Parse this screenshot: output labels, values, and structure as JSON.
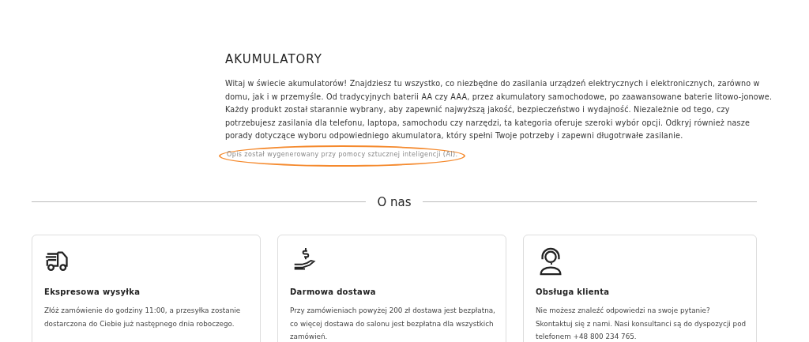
{
  "category": {
    "title": "AKUMULATORY",
    "description": "Witaj w świecie akumulatorów! Znajdziesz tu wszystko, co niezbędne do zasilania urządzeń elektrycznych i elektronicznych, zarówno w domu, jak i w przemyśle. Od tradycyjnych baterii AA czy AAA, przez akumulatory samochodowe, po zaawansowane baterie litowo-jonowe. Każdy produkt został starannie wybrany, aby zapewnić najwyższą jakość, bezpieczeństwo i wydajność. Niezależnie od tego, czy potrzebujesz zasilania dla telefonu, laptopa, samochodu czy narzędzi, ta kategoria oferuje szeroki wybór opcji. Odkryj również nasze porady dotyczące wyboru odpowiedniego akumulatora, który spełni Twoje potrzeby i zapewni długotrwałe zasilanie.",
    "ai_note": {
      "text": "Opis został wygenerowany przy pomocy sztucznej inteligencji (AI).",
      "highlighted": true
    }
  },
  "about": {
    "heading": "O nas",
    "features": [
      {
        "kind": "truck",
        "title": "Ekspresowa wysyłka",
        "text": "Złóż zamówienie do godziny 11:00, a przesyłka zostanie dostarczona do Ciebie już następnego dnia roboczego."
      },
      {
        "kind": "money",
        "title": "Darmowa dostawa",
        "text": "Przy zamówieniach powyżej 200 zł dostawa jest bezpłatna, co więcej dostawa do salonu jest bezpłatna dla wszystkich zamówień."
      },
      {
        "kind": "support",
        "title": "Obsługa klienta",
        "text": "Nie możesz znaleźć odpowiedzi na swoje pytanie? Skontaktuj się z nami. Nasi konsultanci są do dyspozycji pod telefonem +48 800 234 765."
      }
    ]
  }
}
